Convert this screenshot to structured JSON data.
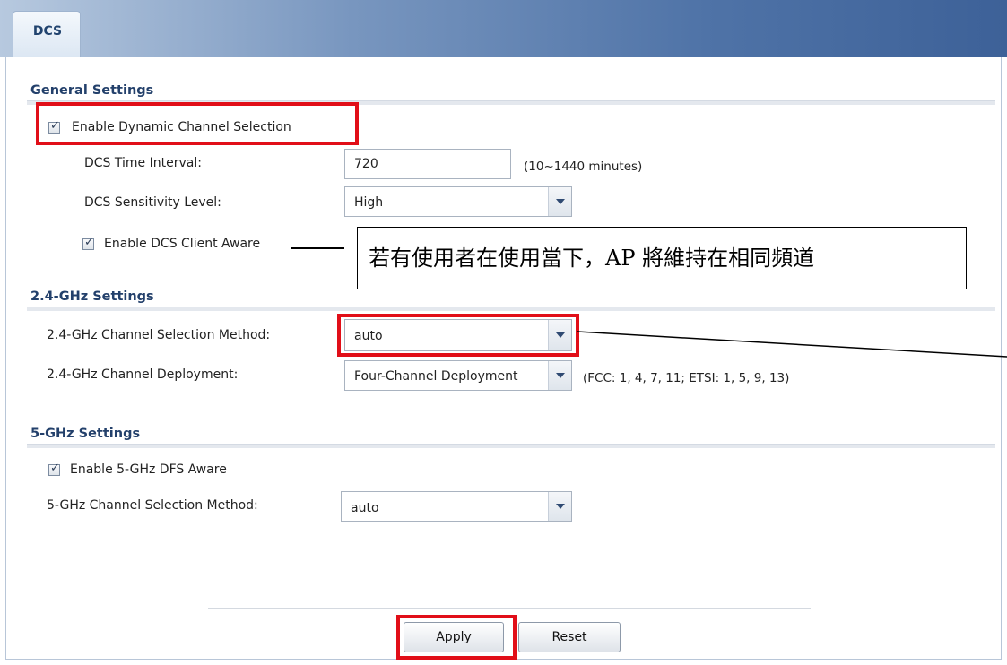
{
  "tab": {
    "label": "DCS"
  },
  "general": {
    "title": "General Settings",
    "enable_dcs_label": "Enable Dynamic Channel Selection",
    "enable_dcs_checked": true,
    "time_interval_label": "DCS Time Interval:",
    "time_interval_value": "720",
    "time_interval_hint": "(10~1440 minutes)",
    "sensitivity_label": "DCS Sensitivity Level:",
    "sensitivity_value": "High",
    "client_aware_label": "Enable DCS Client Aware",
    "client_aware_checked": true
  },
  "callout": {
    "text": "若有使用者在使用當下，AP 將維持在相同頻道"
  },
  "ghz24": {
    "title": "2.4-GHz Settings",
    "method_label": "2.4-GHz Channel Selection Method:",
    "method_value": "auto",
    "deployment_label": "2.4-GHz Channel Deployment:",
    "deployment_value": "Four-Channel Deployment",
    "deployment_hint": "(FCC: 1, 4, 7, 11; ETSI: 1, 5, 9, 13)"
  },
  "ghz5": {
    "title": "5-GHz Settings",
    "dfs_label": "Enable 5-GHz DFS Aware",
    "dfs_checked": true,
    "method_label": "5-GHz Channel Selection Method:",
    "method_value": "auto"
  },
  "buttons": {
    "apply": "Apply",
    "reset": "Reset"
  },
  "colors": {
    "highlight": "#e10e18",
    "section_title": "#23406b",
    "header": "#4f73a7"
  },
  "icons": {
    "checkbox_tick": "✓",
    "dropdown": "chevron-down-icon"
  }
}
